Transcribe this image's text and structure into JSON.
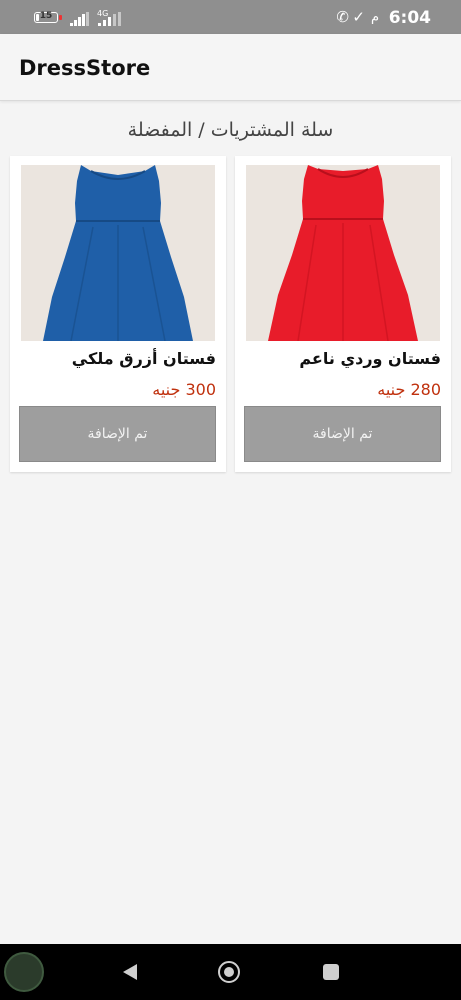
{
  "status_bar": {
    "time": "6:04",
    "ampm": "م",
    "battery_level": "15",
    "battery_fraction": 0.15,
    "network": "4G",
    "icons": [
      "battery-icon",
      "signal-icon",
      "signal-icon",
      "check-icon",
      "call-icon"
    ]
  },
  "app_bar": {
    "title": "DressStore"
  },
  "page": {
    "title": "سلة المشتريات / المفضلة"
  },
  "products": [
    {
      "name": "فستان وردي ناعم",
      "price": "280 جنيه",
      "button_label": "تم الإضافة",
      "dress_color": "#e81c2a"
    },
    {
      "name": "فستان أزرق ملكي",
      "price": "300 جنيه",
      "button_label": "تم الإضافة",
      "dress_color": "#1f5fa8"
    }
  ],
  "colors": {
    "price": "#c0310e",
    "button_bg": "#9e9e9e",
    "background": "#f4f4f4"
  },
  "nav_bar": {
    "icons": [
      "back-icon",
      "home-icon",
      "recent-apps-icon"
    ]
  }
}
